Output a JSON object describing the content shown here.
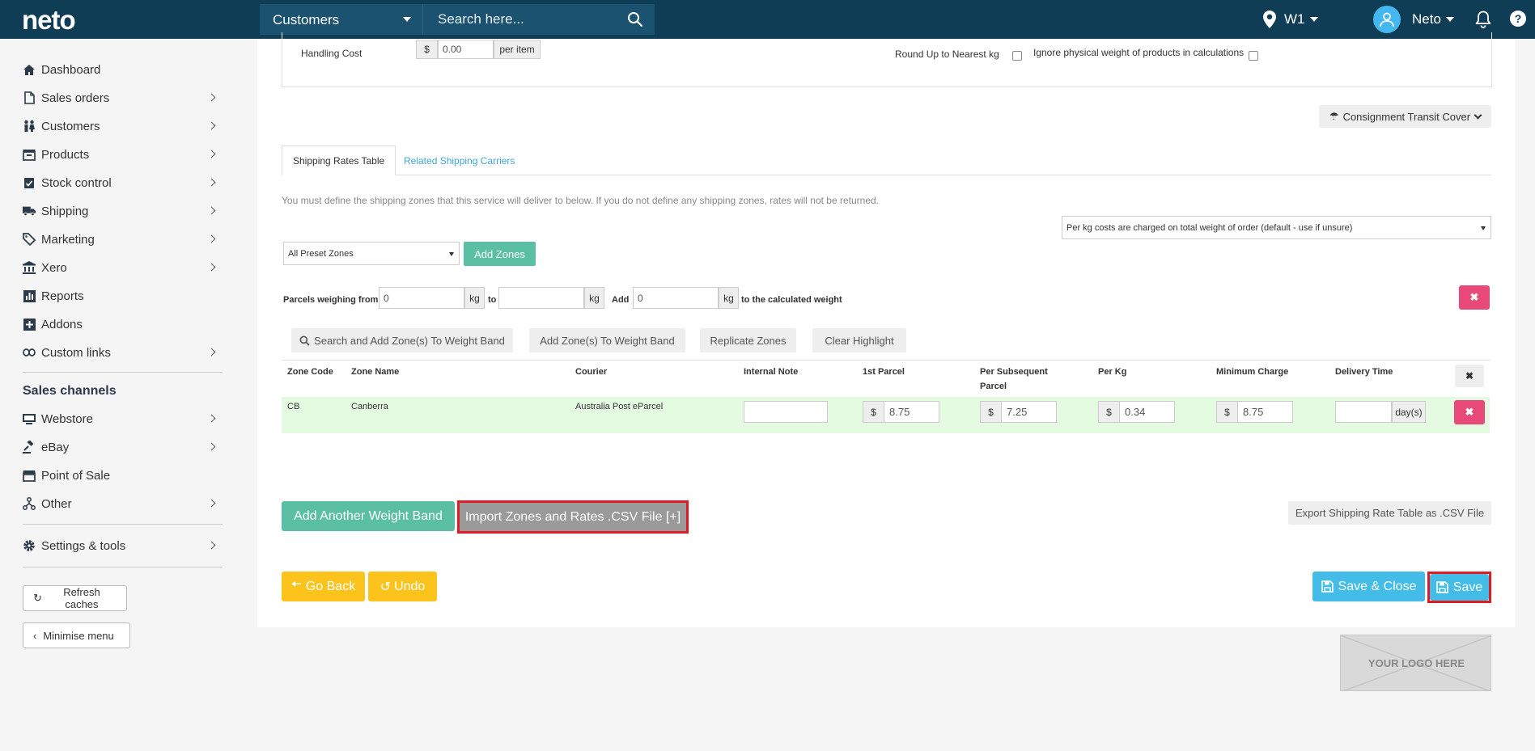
{
  "topbar": {
    "logo": "neto",
    "search_scope": "Customers",
    "search_placeholder": "Search here...",
    "location": "W1",
    "user": "Neto"
  },
  "sidebar": {
    "items": [
      {
        "label": "Dashboard",
        "icon": "home-icon",
        "chevron": false
      },
      {
        "label": "Sales orders",
        "icon": "document-icon",
        "chevron": true
      },
      {
        "label": "Customers",
        "icon": "people-icon",
        "chevron": true
      },
      {
        "label": "Products",
        "icon": "box-icon",
        "chevron": true
      },
      {
        "label": "Stock control",
        "icon": "clipboard-check-icon",
        "chevron": true
      },
      {
        "label": "Shipping",
        "icon": "truck-icon",
        "chevron": true
      },
      {
        "label": "Marketing",
        "icon": "tags-icon",
        "chevron": true
      },
      {
        "label": "Xero",
        "icon": "bank-icon",
        "chevron": true
      },
      {
        "label": "Reports",
        "icon": "bar-chart-icon",
        "chevron": false
      },
      {
        "label": "Addons",
        "icon": "plus-square-icon",
        "chevron": false
      },
      {
        "label": "Custom links",
        "icon": "link-icon",
        "chevron": true
      }
    ],
    "channels_heading": "Sales channels",
    "channels": [
      {
        "label": "Webstore",
        "icon": "monitor-icon",
        "chevron": true
      },
      {
        "label": "eBay",
        "icon": "gavel-icon",
        "chevron": true
      },
      {
        "label": "Point of Sale",
        "icon": "store-icon",
        "chevron": false
      },
      {
        "label": "Other",
        "icon": "sitemap-icon",
        "chevron": true
      }
    ],
    "settings": {
      "label": "Settings & tools",
      "icon": "gear-icon",
      "chevron": true
    },
    "refresh_label": "Refresh caches",
    "minimise_label": "Minimise menu"
  },
  "handling": {
    "label": "Handling Cost",
    "currency": "$",
    "value": "0.00",
    "suffix": "per item",
    "round_label": "Round Up to Nearest kg",
    "ignore_label": "Ignore physical weight of products in calculations"
  },
  "consignment_label": "Consignment Transit Cover",
  "tabs": [
    "Shipping Rates Table",
    "Related Shipping Carriers"
  ],
  "notice": "You must define the shipping zones that this service will deliver to below. If you do not define any shipping zones, rates will not be returned.",
  "per_kg_option": "Per kg costs are charged on total weight of order (default - use if unsure)",
  "preset_zones": "All Preset Zones",
  "add_zones_label": "Add Zones",
  "weight_band": {
    "from_label": "Parcels weighing from",
    "from_value": "0",
    "unit": "kg",
    "to_label": "to",
    "to_value": "",
    "add_label": "Add",
    "add_value": "0",
    "suffix": "to the calculated weight"
  },
  "toolbar": {
    "search_add": "Search and Add Zone(s) To Weight Band",
    "add_zones": "Add Zone(s) To Weight Band",
    "replicate": "Replicate Zones",
    "clear": "Clear Highlight"
  },
  "table": {
    "headers": [
      "Zone Code",
      "Zone Name",
      "Courier",
      "Internal Note",
      "1st Parcel",
      "Per Subsequent Parcel",
      "Per Kg",
      "Minimum Charge",
      "Delivery Time"
    ],
    "row": {
      "zone_code": "CB",
      "zone_name": "Canberra",
      "courier": "Australia Post eParcel",
      "internal_note": "",
      "currency": "$",
      "first_parcel": "8.75",
      "per_subsequent": "7.25",
      "per_kg": "0.34",
      "minimum_charge": "8.75",
      "delivery_time": "",
      "delivery_unit": "day(s)"
    }
  },
  "actions": {
    "add_band": "Add Another Weight Band",
    "import_csv": "Import Zones and Rates .CSV File [+]",
    "export_csv": "Export Shipping Rate Table as .CSV File",
    "go_back": "Go Back",
    "undo": "Undo",
    "save_close": "Save & Close",
    "save": "Save",
    "delete_symbol": "✖"
  },
  "logo_placeholder": "YOUR LOGO HERE",
  "colors": {
    "topbar": "#0f3d55",
    "teal": "#5bbfa4",
    "pink": "#e94978",
    "yellow": "#fcc31d",
    "blue": "#43bde8",
    "highlight_row": "#e4fbe2",
    "annotation_red": "#e01b24"
  }
}
